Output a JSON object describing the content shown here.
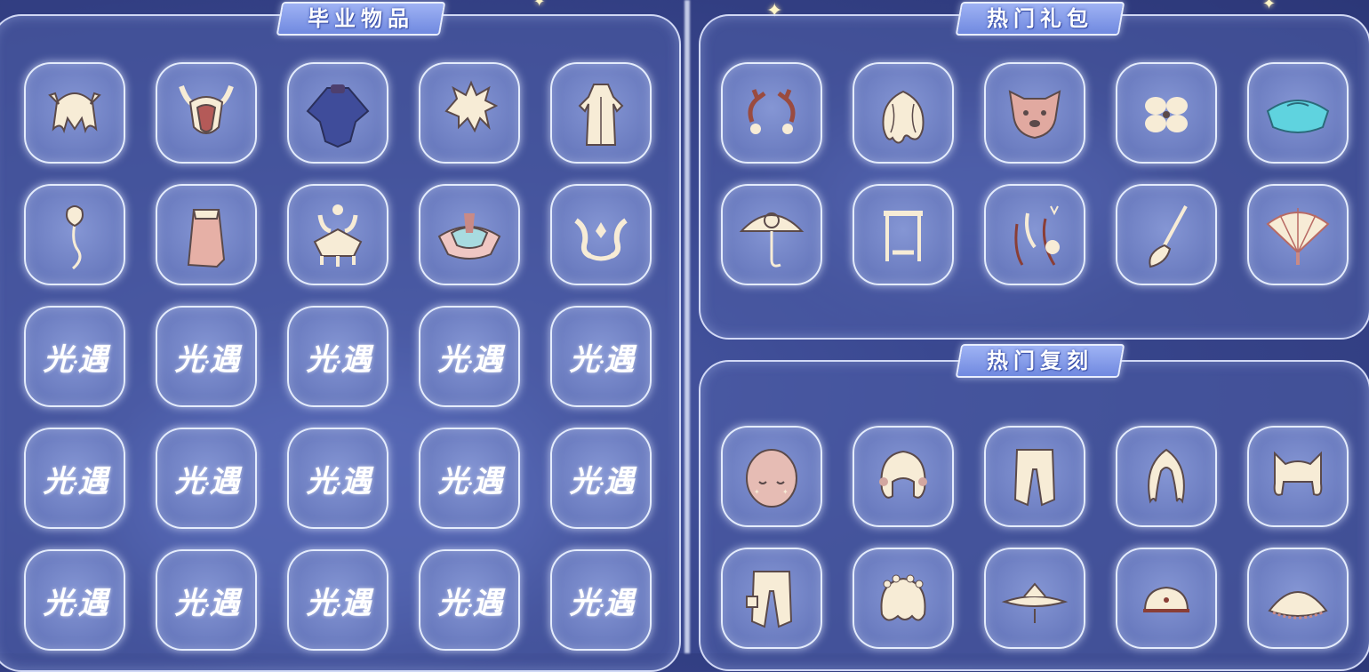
{
  "sections": {
    "graduation": {
      "title": "毕业物品"
    },
    "gift": {
      "title": "热门礼包"
    },
    "rerun": {
      "title": "热门复刻"
    }
  },
  "logo": {
    "part1": "光",
    "dot": "·",
    "part2": "遇"
  },
  "graduation_items": [
    "hair-icon",
    "horned-mask-icon",
    "cape-icon",
    "spiky-hair-icon",
    "robe-outfit-icon",
    "rose-icon",
    "scarf-icon",
    "horned-mask-ornate-icon",
    "wing-cape-icon",
    "wing-mask-icon",
    "logo",
    "logo",
    "logo",
    "logo",
    "logo",
    "logo",
    "logo",
    "logo",
    "logo",
    "logo",
    "logo",
    "logo",
    "logo",
    "logo",
    "logo"
  ],
  "gift_items": [
    "antlers-icon",
    "curly-hair-icon",
    "bear-mask-icon",
    "flower-hairpin-icon",
    "teal-cape-icon",
    "umbrella-icon",
    "swing-icon",
    "cat-ear-rope-icon",
    "broom-icon",
    "folding-fan-icon"
  ],
  "rerun_items": [
    "round-mask-icon",
    "bob-hair-icon",
    "pants-icon",
    "wavy-hair-icon",
    "cat-ear-hair-icon",
    "cargo-pants-icon",
    "flower-crown-hair-icon",
    "bamboo-hat-icon",
    "cap-icon",
    "lace-cape-icon"
  ],
  "colors": {
    "accent": "#7089e0",
    "slot": "#6a7bbf",
    "background": "#3a4890"
  }
}
